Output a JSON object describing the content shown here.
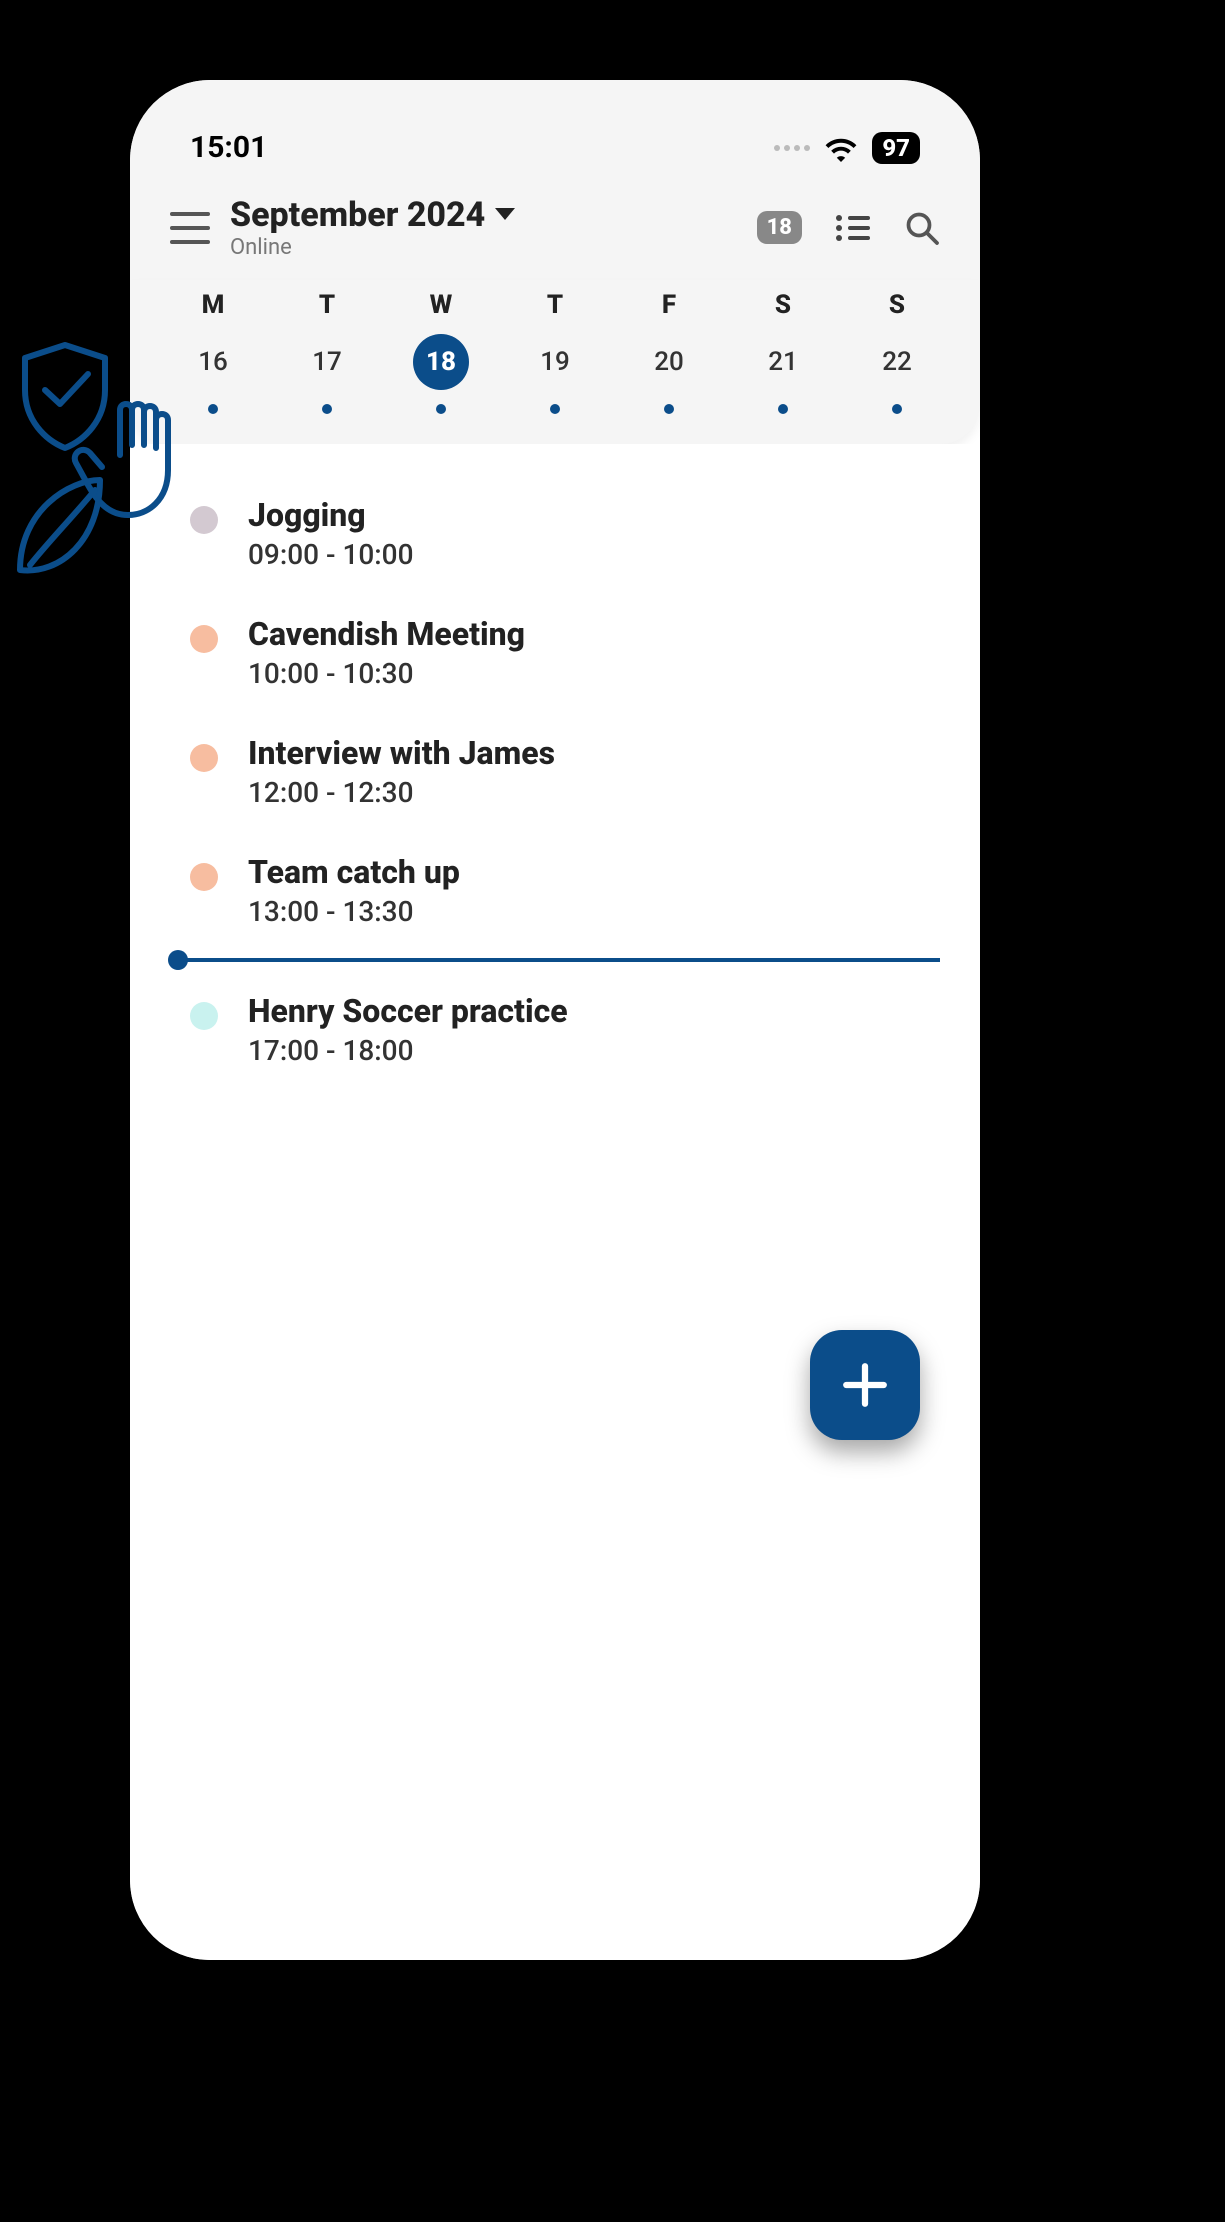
{
  "status_bar": {
    "time": "15:01",
    "battery": "97"
  },
  "header": {
    "month_label": "September 2024",
    "status": "Online",
    "date_badge": "18"
  },
  "week": {
    "day_letters": [
      "M",
      "T",
      "W",
      "T",
      "F",
      "S",
      "S"
    ],
    "day_numbers": [
      "16",
      "17",
      "18",
      "19",
      "20",
      "21",
      "22"
    ],
    "selected_index": 2
  },
  "events": [
    {
      "title": "Jogging",
      "time": "09:00 - 10:00",
      "color": "#d3c9d1"
    },
    {
      "title": "Cavendish Meeting",
      "time": "10:00 - 10:30",
      "color": "#f7bda0"
    },
    {
      "title": "Interview with James",
      "time": "12:00 - 12:30",
      "color": "#f7bda0"
    },
    {
      "title": "Team catch up",
      "time": "13:00 - 13:30",
      "color": "#f7bda0"
    },
    {
      "title": "Henry Soccer practice",
      "time": "17:00 - 18:00",
      "color": "#c9f2ef"
    }
  ],
  "now_after_index": 3,
  "colors": {
    "accent": "#0b4d8a"
  }
}
